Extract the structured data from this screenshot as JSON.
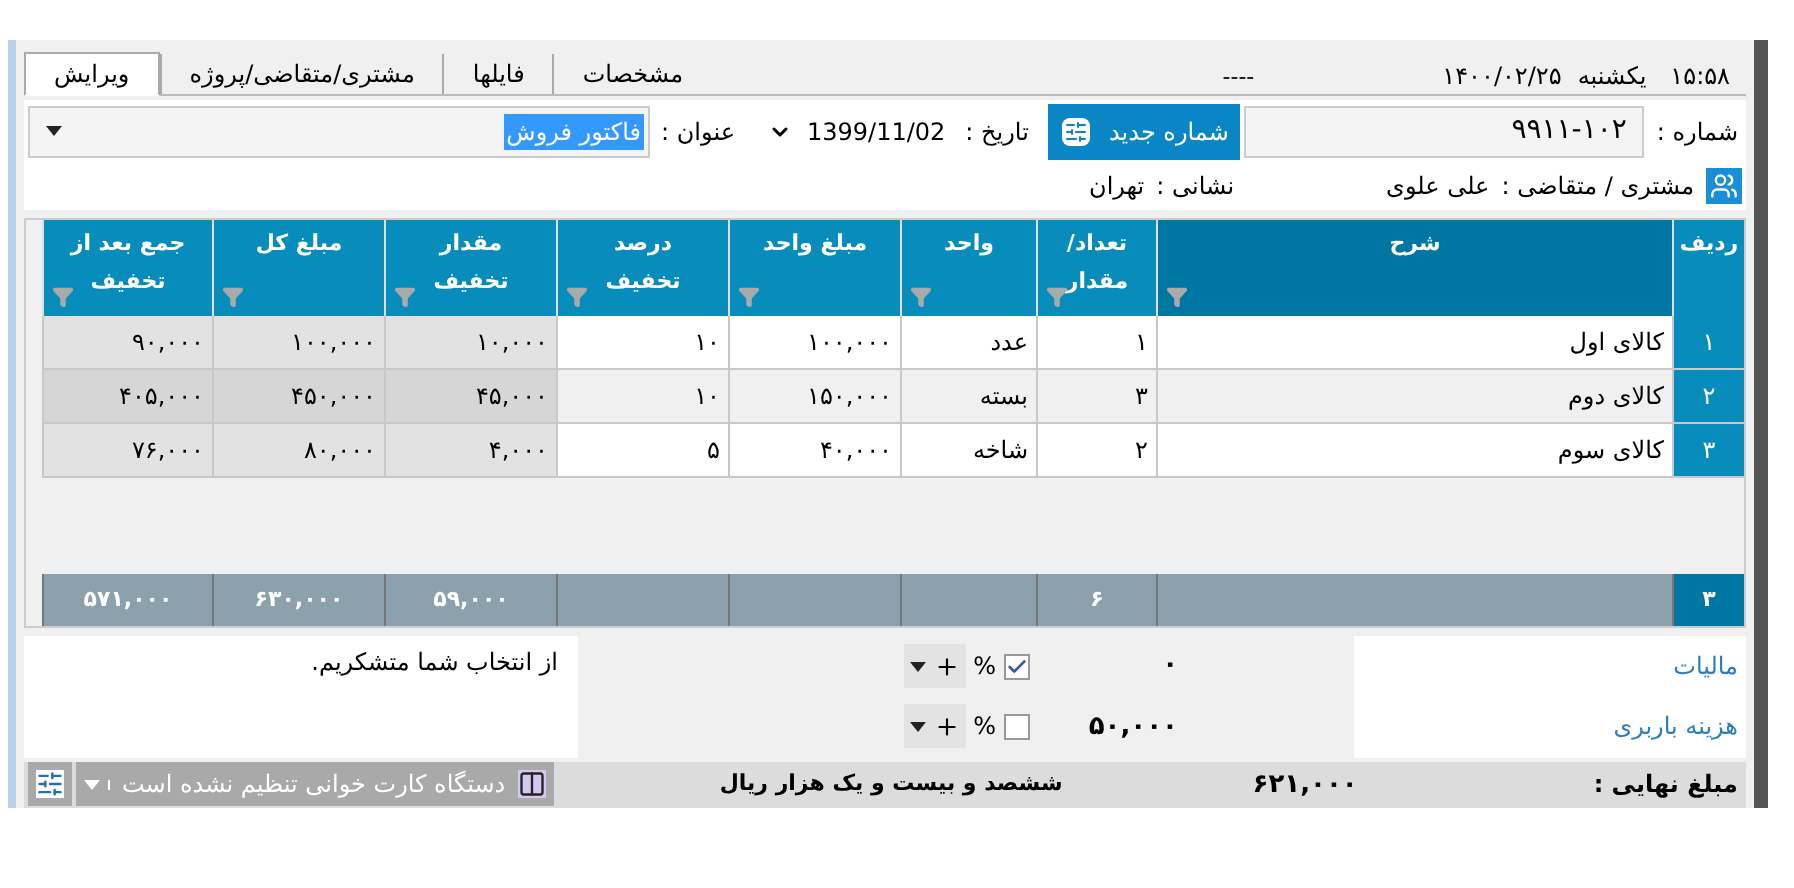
{
  "header": {
    "time": "۱۵:۵۸",
    "weekday": "یکشنبه",
    "date": "۱۴۰۰/۰۲/۲۵",
    "status": "----"
  },
  "tabs": [
    {
      "label": "مشخصات",
      "selected": false
    },
    {
      "label": "فایلها",
      "selected": false
    },
    {
      "label": "مشتری/متقاضی/پروژه",
      "selected": false
    },
    {
      "label": "ویرایش",
      "selected": true
    }
  ],
  "form": {
    "number_label": "شماره :",
    "number": "۹۹۱۱-۱۰۲",
    "new_number_button": "شماره جدید",
    "date_label": "تاریخ :",
    "date": "1399/11/02",
    "title_label": "عنوان :",
    "title": "فاکتور فروش",
    "customer_label": "مشتری / متقاضی :",
    "customer": "علی علوی",
    "address_label": "نشانی :",
    "address": "تهران"
  },
  "table": {
    "columns": [
      {
        "label": "ردیف",
        "kind": "index",
        "selected": false
      },
      {
        "label": "شرح",
        "kind": "text",
        "selected": true,
        "readonly": false
      },
      {
        "label": "تعداد/\nمقدار",
        "kind": "text",
        "selected": false,
        "readonly": false
      },
      {
        "label": "واحد",
        "kind": "text",
        "selected": false,
        "readonly": false
      },
      {
        "label": "مبلغ واحد",
        "kind": "text",
        "selected": false,
        "readonly": false
      },
      {
        "label": "درصد\nتخفیف",
        "kind": "text",
        "selected": false,
        "readonly": false
      },
      {
        "label": "مقدار\nتخفیف",
        "kind": "text",
        "selected": false,
        "readonly": true
      },
      {
        "label": "مبلغ کل",
        "kind": "text",
        "selected": false,
        "readonly": true
      },
      {
        "label": "جمع بعد از\nتخفیف",
        "kind": "text",
        "selected": false,
        "readonly": true
      }
    ],
    "rows": [
      [
        "۱",
        "کالای اول",
        "۱",
        "عدد",
        "۱۰۰,۰۰۰",
        "۱۰",
        "۱۰,۰۰۰",
        "۱۰۰,۰۰۰",
        "۹۰,۰۰۰"
      ],
      [
        "۲",
        "کالای دوم",
        "۳",
        "بسته",
        "۱۵۰,۰۰۰",
        "۱۰",
        "۴۵,۰۰۰",
        "۴۵۰,۰۰۰",
        "۴۰۵,۰۰۰"
      ],
      [
        "۳",
        "کالای سوم",
        "۲",
        "شاخه",
        "۴۰,۰۰۰",
        "۵",
        "۴,۰۰۰",
        "۸۰,۰۰۰",
        "۷۶,۰۰۰"
      ]
    ]
  },
  "summary": {
    "row_count": "۳",
    "quantity_total": "۶",
    "discount_total": "۵۹,۰۰۰",
    "amount_total": "۶۳۰,۰۰۰",
    "net_total": "۵۷۱,۰۰۰"
  },
  "charges": [
    {
      "label": "مالیات",
      "value": "۰",
      "percent_checked": true,
      "percent_sign": "%"
    },
    {
      "label": "هزینه باربری",
      "value": "۵۰,۰۰۰",
      "percent_checked": false,
      "percent_sign": "%"
    }
  ],
  "note": "از انتخاب شما متشکریم.",
  "footer": {
    "final_label": "مبلغ نهایی :",
    "final_amount": "۶۲۱,۰۰۰",
    "amount_words": "ششصد و بیست و یک هزار ریال",
    "card_reader": "دستگاه کارت خوانی تنظیم نشده است"
  }
}
